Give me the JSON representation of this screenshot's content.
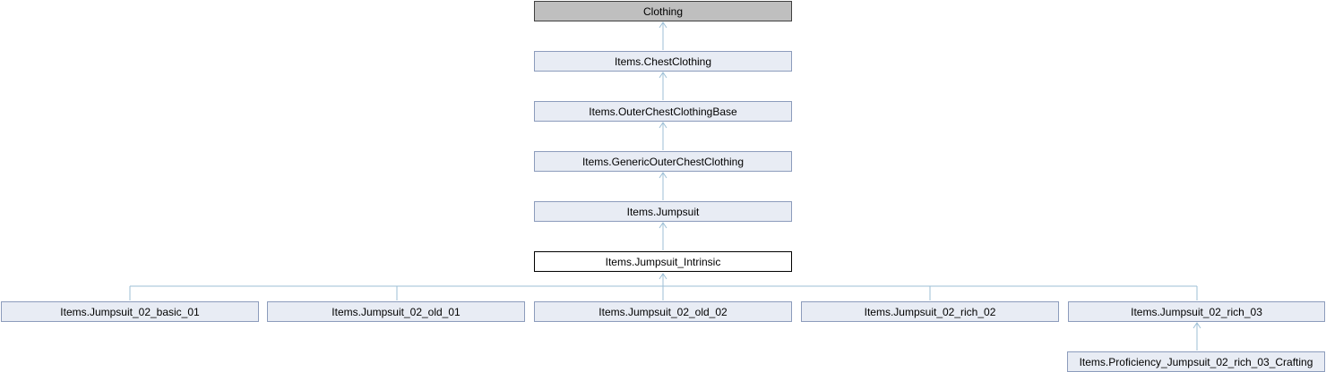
{
  "nodes": {
    "clothing": "Clothing",
    "chest_clothing": "Items.ChestClothing",
    "outer_chest_clothing_base": "Items.OuterChestClothingBase",
    "generic_outer_chest_clothing": "Items.GenericOuterChestClothing",
    "jumpsuit": "Items.Jumpsuit",
    "jumpsuit_intrinsic": "Items.Jumpsuit_Intrinsic",
    "jumpsuit_02_basic_01": "Items.Jumpsuit_02_basic_01",
    "jumpsuit_02_old_01": "Items.Jumpsuit_02_old_01",
    "jumpsuit_02_old_02": "Items.Jumpsuit_02_old_02",
    "jumpsuit_02_rich_02": "Items.Jumpsuit_02_rich_02",
    "jumpsuit_02_rich_03": "Items.Jumpsuit_02_rich_03",
    "proficiency_jumpsuit_02_rich_03_crafting": "Items.Proficiency_Jumpsuit_02_rich_03_Crafting"
  },
  "colors": {
    "edge": "#9cbfd6",
    "root_fill": "#bfbfbf",
    "link_fill": "#e8ecf4",
    "link_border": "#8c9cbc",
    "current_fill": "#ffffff"
  }
}
